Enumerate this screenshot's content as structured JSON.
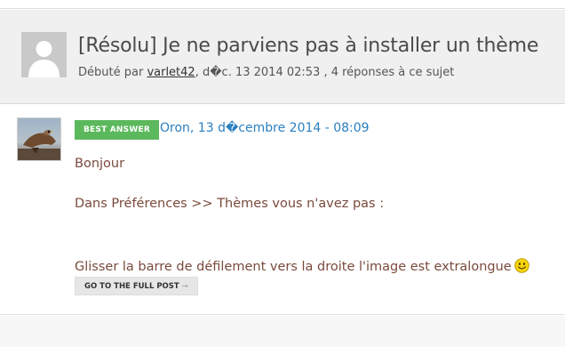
{
  "topic": {
    "title": "[Résolu] Je ne parviens pas à installer un thème",
    "meta_prefix": "Débuté par ",
    "author": "varlet42",
    "meta_suffix": ", d�c. 13 2014 02:53 , 4 réponses à ce sujet"
  },
  "post": {
    "badge": "BEST ANSWER",
    "date": "Oron, 13 d�cembre 2014 - 08:09",
    "lines": [
      "Bonjour",
      "Dans Préférences >> Thèmes vous n'avez pas :",
      "Glisser la barre de défilement vers la  droite l'image est extralongue"
    ],
    "smiley_icon": "smiley-icon",
    "full_post_label": "GO TO THE FULL POST",
    "full_post_arrow": "→"
  },
  "colors": {
    "badge_bg": "#5cb85c",
    "date_link": "#2a7fc0",
    "body_text": "#7a4a3c"
  }
}
